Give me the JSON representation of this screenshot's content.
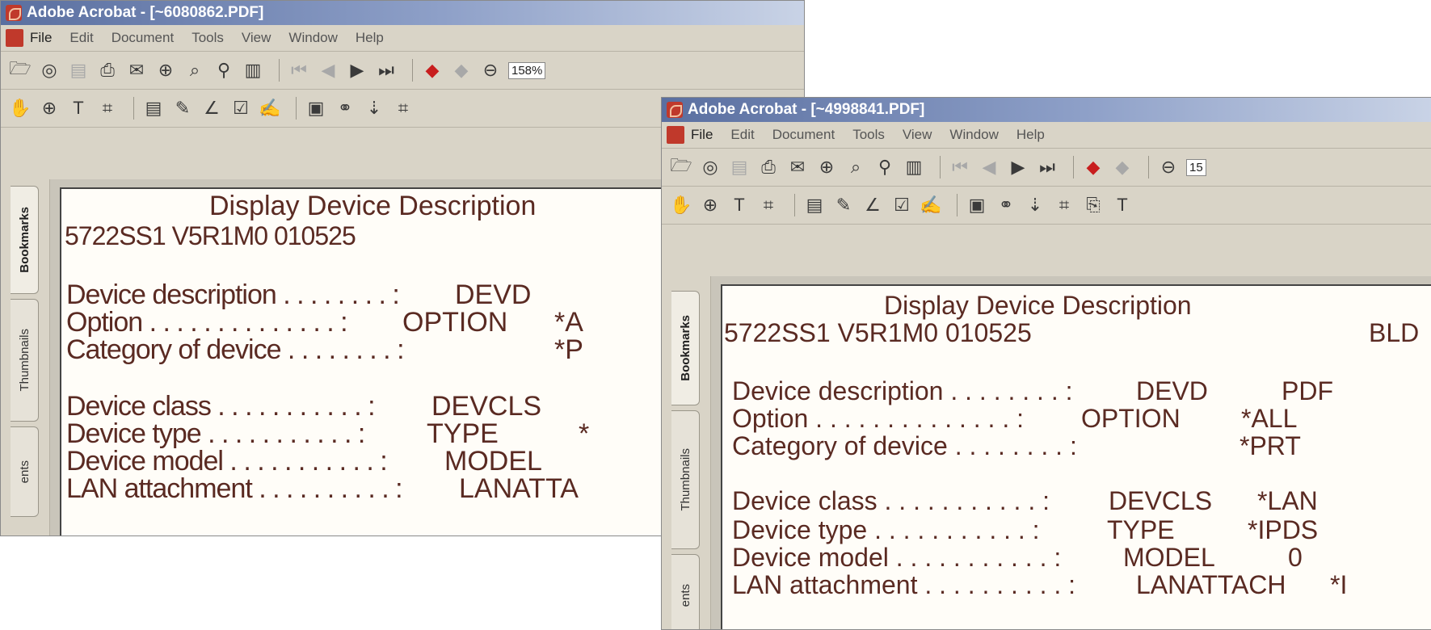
{
  "windows": [
    {
      "title": "Adobe Acrobat - [~6080862.PDF]",
      "menu": [
        "File",
        "Edit",
        "Document",
        "Tools",
        "View",
        "Window",
        "Help"
      ],
      "zoom": "158%",
      "nav_tabs": [
        "Bookmarks",
        "Thumbnails",
        "ents"
      ],
      "doc": {
        "heading": "Display Device Description",
        "subline": "5722SS1 V5R1M0  010525",
        "rows": [
          {
            "label": "Device description . . . . . . . . :",
            "keyword": "DEVD",
            "value": ""
          },
          {
            "label": "Option . . . . . . . . . . . . . . :",
            "keyword": "OPTION",
            "value": "*A"
          },
          {
            "label": "Category of device . . . . . . . . :",
            "keyword": "",
            "value": "*P"
          },
          {
            "label": "Device class . . . . . . . . . . . :",
            "keyword": "DEVCLS",
            "value": ""
          },
          {
            "label": "Device type  . . . . . . . . . . . :",
            "keyword": "TYPE",
            "value": "*"
          },
          {
            "label": "Device model . . . . . . . . . . . :",
            "keyword": "MODEL",
            "value": ""
          },
          {
            "label": "LAN attachment . . . . . . . . . . :",
            "keyword": "LANATTA",
            "value": ""
          }
        ]
      }
    },
    {
      "title": "Adobe Acrobat - [~4998841.PDF]",
      "menu": [
        "File",
        "Edit",
        "Document",
        "Tools",
        "View",
        "Window",
        "Help"
      ],
      "zoom": "15",
      "nav_tabs": [
        "Bookmarks",
        "Thumbnails",
        "ents"
      ],
      "doc": {
        "heading": "Display Device Description",
        "subline": "5722SS1 V5R1M0  010525",
        "subline_right": "BLD",
        "rows": [
          {
            "label": "Device description . . . . . . . . :",
            "keyword": "DEVD",
            "value": "PDF"
          },
          {
            "label": "Option . . . . . . . . . . . . . . :",
            "keyword": "OPTION",
            "value": "*ALL"
          },
          {
            "label": "Category of device . . . . . . . . :",
            "keyword": "",
            "value": "*PRT"
          },
          {
            "label": "Device class . . . . . . . . . . . :",
            "keyword": "DEVCLS",
            "value": "*LAN"
          },
          {
            "label": "Device type  . . . . . . . . . . . :",
            "keyword": "TYPE",
            "value": "*IPDS"
          },
          {
            "label": "Device model . . . . . . . . . . . :",
            "keyword": "MODEL",
            "value": "0"
          },
          {
            "label": "LAN attachment . . . . . . . . . . :",
            "keyword": "LANATTACH",
            "value": "*I"
          }
        ]
      }
    }
  ],
  "colors": {
    "title_start": "#5a6fa0",
    "doc_text": "#5a2a22",
    "chrome": "#d9d4c7"
  }
}
